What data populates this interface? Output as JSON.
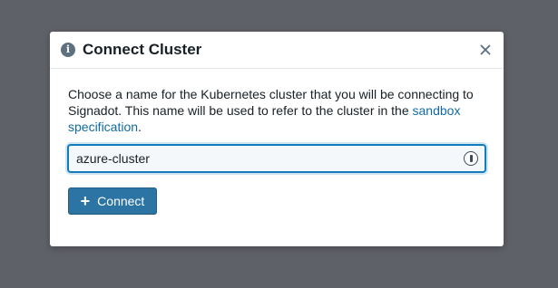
{
  "dialog": {
    "title": "Connect Cluster",
    "title_icon": "info-icon",
    "close_icon": "close-icon"
  },
  "body": {
    "description_prefix": "Choose a name for the Kubernetes cluster that you will be connecting to Signadot. This name will be used to refer to the cluster in the ",
    "link_text": "sandbox specification",
    "description_suffix": "."
  },
  "input": {
    "value": "azure-cluster",
    "trailing_icon": "password-manager-icon"
  },
  "button": {
    "label": "Connect",
    "icon": "plus-icon"
  },
  "colors": {
    "backdrop": "#5f6168",
    "primary": "#2b74a4",
    "link": "#106ba3"
  }
}
